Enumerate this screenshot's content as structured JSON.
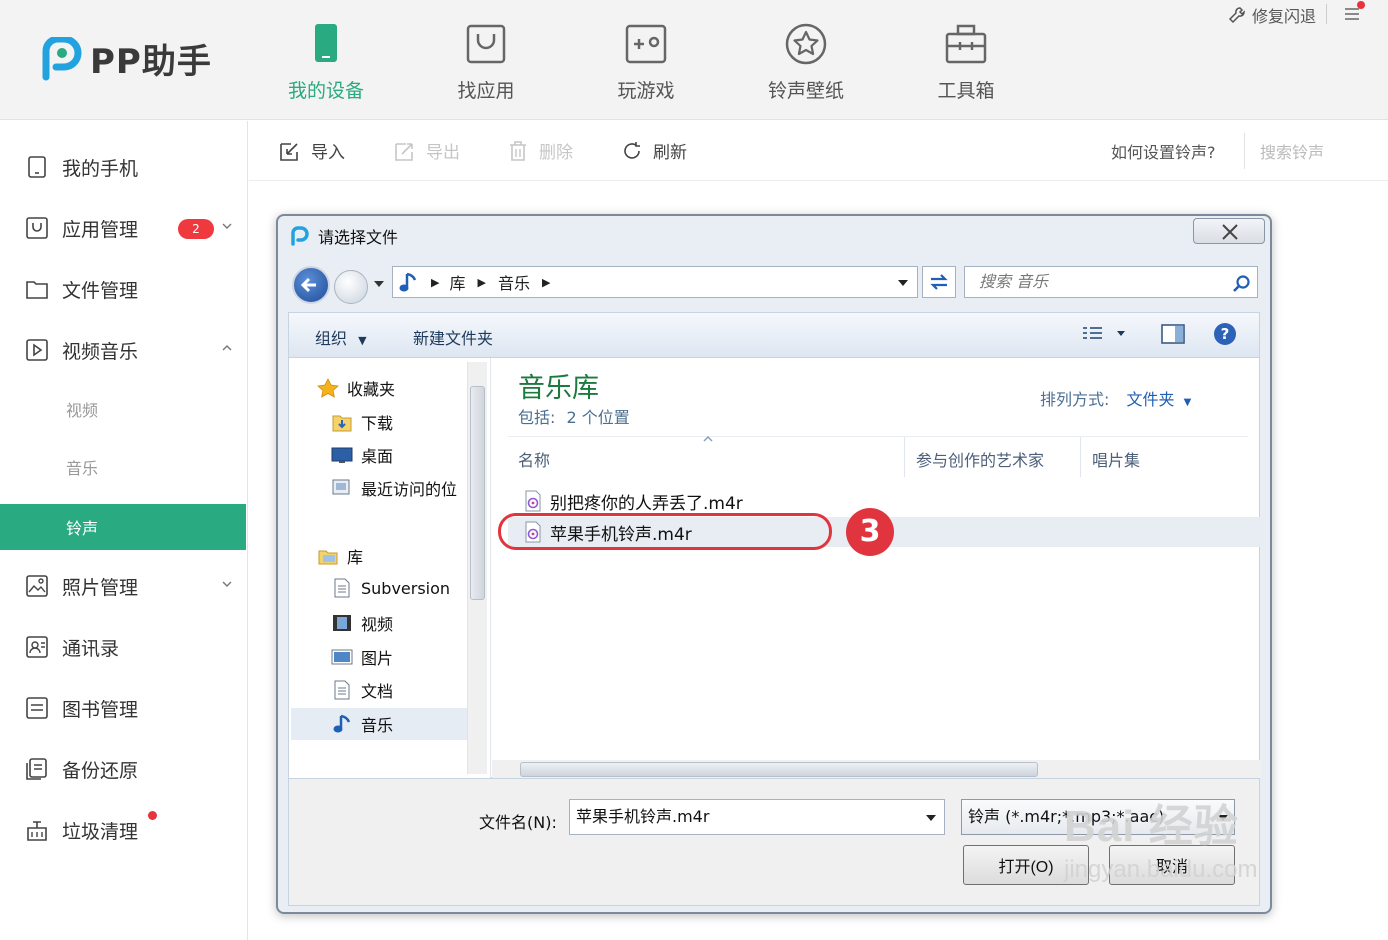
{
  "app": {
    "name": "PP助手"
  },
  "header": {
    "tabs": [
      {
        "label": "我的设备",
        "icon": "phone-icon",
        "active": true
      },
      {
        "label": "找应用",
        "icon": "app-bag-icon",
        "active": false
      },
      {
        "label": "玩游戏",
        "icon": "gamepad-icon",
        "active": false
      },
      {
        "label": "铃声壁纸",
        "icon": "star-circle-icon",
        "active": false
      },
      {
        "label": "工具箱",
        "icon": "toolbox-icon",
        "active": false
      }
    ],
    "repair_label": "修复闪退"
  },
  "sidebar": {
    "items": [
      {
        "label": "我的手机",
        "icon": "phone-outline-icon"
      },
      {
        "label": "应用管理",
        "icon": "app-manage-icon",
        "badge": "2"
      },
      {
        "label": "文件管理",
        "icon": "folder-icon"
      },
      {
        "label": "视频音乐",
        "icon": "play-icon",
        "expanded": true
      },
      {
        "label": "照片管理",
        "icon": "photo-icon"
      },
      {
        "label": "通讯录",
        "icon": "contacts-icon"
      },
      {
        "label": "图书管理",
        "icon": "book-icon"
      },
      {
        "label": "备份还原",
        "icon": "backup-icon"
      },
      {
        "label": "垃圾清理",
        "icon": "trash-clean-icon"
      }
    ],
    "subitems": [
      {
        "label": "视频",
        "active": false
      },
      {
        "label": "音乐",
        "active": false
      },
      {
        "label": "铃声",
        "active": true
      }
    ]
  },
  "toolbar": {
    "import_label": "导入",
    "export_label": "导出",
    "delete_label": "删除",
    "refresh_label": "刷新",
    "help_link": "如何设置铃声?",
    "search_placeholder": "搜索铃声"
  },
  "dialog": {
    "title": "请选择文件",
    "breadcrumb": [
      "库",
      "音乐"
    ],
    "search_placeholder": "搜索 音乐",
    "organize_label": "组织",
    "new_folder_label": "新建文件夹",
    "nav": {
      "favorites_label": "收藏夹",
      "favorites": [
        "下载",
        "桌面",
        "最近访问的位"
      ],
      "libraries_label": "库",
      "libraries": [
        "Subversion",
        "视频",
        "图片",
        "文档",
        "音乐"
      ]
    },
    "library_title": "音乐库",
    "includes_label": "包括:",
    "includes_link": "2 个位置",
    "sort_label": "排列方式:",
    "sort_value": "文件夹",
    "columns": [
      "名称",
      "参与创作的艺术家",
      "唱片集"
    ],
    "files": [
      {
        "name": "别把疼你的人弄丢了.m4r",
        "selected": false
      },
      {
        "name": "苹果手机铃声.m4r",
        "selected": true
      }
    ],
    "filename_label": "文件名(N):",
    "filename_value": "苹果手机铃声.m4r",
    "filetype_value": "铃声 (*.m4r;*.mp3;*.aac)",
    "open_label": "打开(O)",
    "cancel_label": "取消"
  },
  "annotation": {
    "step": "3"
  },
  "watermark": {
    "main": "Bai 经验",
    "sub": "jingyan.baidu.com"
  },
  "colors": {
    "accent": "#2aaa80",
    "badge": "#f0393e",
    "annotation": "#e0353e"
  }
}
